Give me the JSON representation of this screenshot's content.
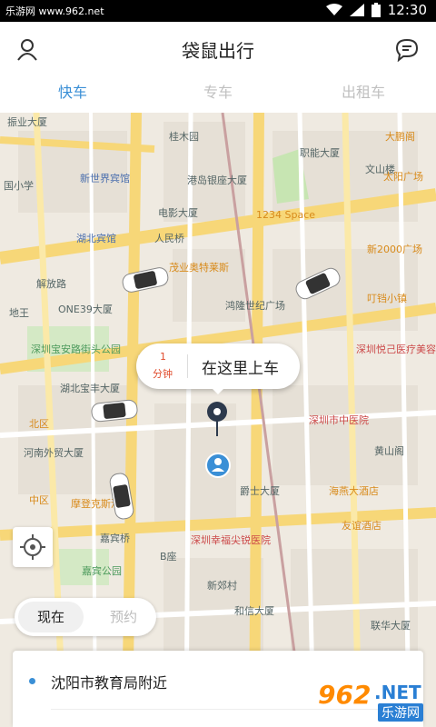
{
  "status_bar": {
    "site": "乐游网 www.962.net",
    "time": "12:30"
  },
  "header": {
    "title": "袋鼠出行",
    "profile_icon": "user-icon",
    "message_icon": "chat-icon"
  },
  "tabs": [
    {
      "label": "快车",
      "active": true
    },
    {
      "label": "专车",
      "active": false
    },
    {
      "label": "出租车",
      "active": false
    }
  ],
  "map": {
    "pois": [
      {
        "label": "深圳宝安路街头公园",
        "color": "green"
      },
      {
        "label": "湖北宝丰大厦"
      },
      {
        "label": "河南外贸大厦"
      },
      {
        "label": "北区",
        "color": "orange"
      },
      {
        "label": "中区",
        "color": "orange"
      },
      {
        "label": "摩登克斯酒店",
        "color": "orange"
      },
      {
        "label": "嘉宾公园",
        "color": "green"
      },
      {
        "label": "深圳幸福尖锐医院",
        "color": "red"
      },
      {
        "label": "深圳市中医院",
        "color": "red"
      },
      {
        "label": "海燕大酒店",
        "color": "orange"
      },
      {
        "label": "友谊酒店",
        "color": "orange"
      },
      {
        "label": "黄山阁"
      },
      {
        "label": "联华大厦"
      },
      {
        "label": "和信大厦"
      },
      {
        "label": "新郊村"
      },
      {
        "label": "B座"
      },
      {
        "label": "爵士大厦"
      },
      {
        "label": "新世界宾馆",
        "color": "blue"
      },
      {
        "label": "湖北宾馆",
        "color": "blue"
      },
      {
        "label": "电影大厦"
      },
      {
        "label": "桂木园"
      },
      {
        "label": "港岛银座大厦"
      },
      {
        "label": "1234 Space",
        "color": "orange"
      },
      {
        "label": "太阳广场",
        "color": "orange"
      },
      {
        "label": "新2000广场",
        "color": "orange"
      },
      {
        "label": "叮铛小镇",
        "color": "orange"
      },
      {
        "label": "茂业奥特莱斯",
        "color": "orange"
      },
      {
        "label": "鸿隆世纪广场"
      },
      {
        "label": "深圳悦己医疗美容医院",
        "color": "red"
      },
      {
        "label": "ONE39大厦"
      },
      {
        "label": "文山楼"
      },
      {
        "label": "职能大厦"
      },
      {
        "label": "大鹏阁",
        "color": "orange"
      },
      {
        "label": "振业大厦"
      },
      {
        "label": "解放路"
      },
      {
        "label": "地王"
      },
      {
        "label": "嘉宾桥"
      },
      {
        "label": "人民桥"
      },
      {
        "label": "国小学"
      }
    ],
    "bubble": {
      "eta_value": "1",
      "eta_unit": "分钟",
      "label": "在这里上车"
    },
    "locate_icon": "crosshair-icon",
    "car_icon": "car-icon"
  },
  "time_switch": {
    "now": "现在",
    "reserve": "预约"
  },
  "address": {
    "text": "沈阳市教育局附近"
  },
  "watermark": {
    "number": "962",
    "net": ".NET",
    "cn": "乐游网"
  }
}
